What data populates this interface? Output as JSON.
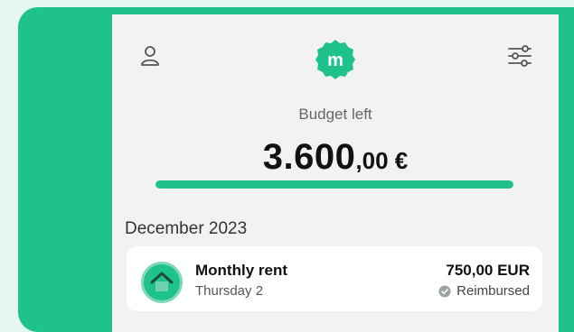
{
  "colors": {
    "accent": "#1fc28d",
    "background": "#f2f2f2"
  },
  "header": {
    "profile_icon": "user-icon",
    "logo_letter": "m",
    "filter_icon": "sliders-icon"
  },
  "budget": {
    "label": "Budget left",
    "amount_whole": "3.600",
    "amount_decimal": ",00 €",
    "progress_fraction": 1.0
  },
  "section": {
    "title": "December 2023"
  },
  "transactions": [
    {
      "icon": "home-icon",
      "title": "Monthly rent",
      "date": "Thursday 2",
      "amount": "750,00 EUR",
      "status": "Reimbursed",
      "status_icon": "check-circle-icon"
    }
  ]
}
